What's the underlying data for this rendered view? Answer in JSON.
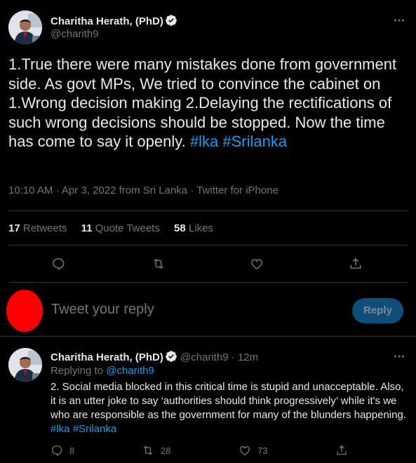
{
  "main_tweet": {
    "author_name": "Charitha Herath, (PhD)",
    "handle": "@charith9",
    "text_plain": "1.True there were many mistakes done from government side. As govt MPs, We tried to convince the cabinet on 1.Wrong decision making 2.Delaying the rectifications of such wrong decisions should be stopped. Now the time has come to say it openly.",
    "hashtag_1": "#lka",
    "hashtag_2": "#Srilanka",
    "meta": "10:10 AM · Apr 3, 2022 from Sri Lanka · Twitter for iPhone",
    "stats": {
      "retweets_count": "17",
      "retweets_label": "Retweets",
      "quotes_count": "11",
      "quotes_label": "Quote Tweets",
      "likes_count": "58",
      "likes_label": "Likes"
    },
    "actions": [
      "reply-icon",
      "retweet-icon",
      "like-icon",
      "share-icon"
    ]
  },
  "compose": {
    "placeholder": "Tweet your reply",
    "reply_button": "Reply"
  },
  "reply_tweet": {
    "author_name": "Charitha Herath, (PhD)",
    "handle": "@charith9",
    "time": "· 12m",
    "replying_to_label": "Replying to",
    "replying_to_handle": "@charith9",
    "text_plain": "2. Social media blocked in this critical time is stupid and unacceptable. Also, it is an utter joke to say ‘authorities should think progressively’ while it's we who are responsible as the government for many of the blunders happening.",
    "hashtag_1": "#lka",
    "hashtag_2": "#Srilanka",
    "reply_count": "8",
    "retweet_count": "28",
    "like_count": "73"
  },
  "colors": {
    "background": "#000000",
    "text": "#e7e9ea",
    "muted": "#71767b",
    "accent": "#1d9bf0",
    "reply_button_bg": "#0f4e78",
    "divider": "#2f3336",
    "redaction": "#ff0000"
  }
}
